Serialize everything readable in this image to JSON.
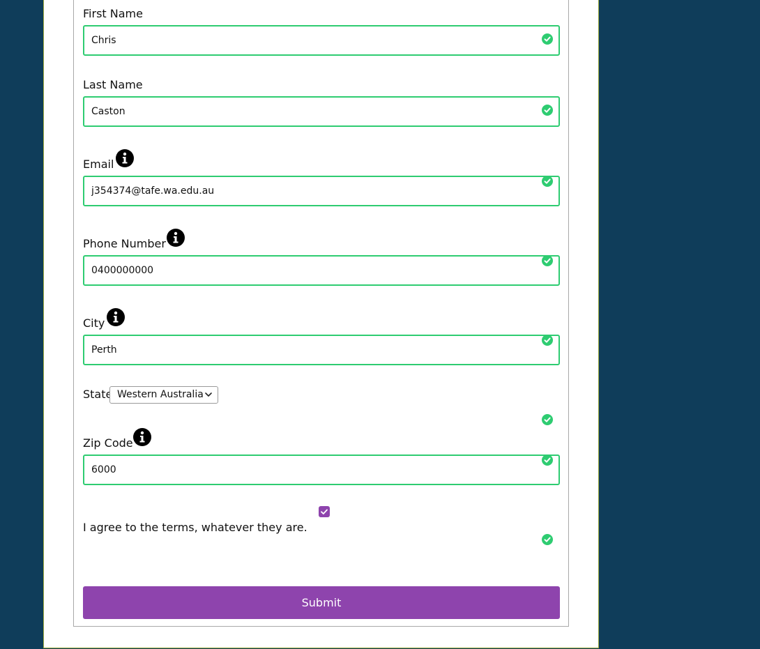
{
  "colors": {
    "background": "#0f3d5a",
    "valid": "#2ecc71",
    "accent": "#8e44ad"
  },
  "form": {
    "first_name": {
      "label": "First Name",
      "value": "Chris"
    },
    "last_name": {
      "label": "Last Name",
      "value": "Caston"
    },
    "email": {
      "label": "Email",
      "value": "j354374@tafe.wa.edu.au"
    },
    "phone": {
      "label": "Phone Number",
      "value": "0400000000"
    },
    "city": {
      "label": "City",
      "value": "Perth"
    },
    "state": {
      "label": "State",
      "value": "Western Australia"
    },
    "zip": {
      "label": "Zip Code",
      "value": "6000"
    },
    "terms": {
      "label": "I agree to the terms, whatever they are.",
      "checked": true
    },
    "submit_label": "Submit"
  },
  "icons": {
    "info": "info-icon",
    "valid": "check-circle-icon",
    "dropdown": "chevron-down-icon"
  }
}
